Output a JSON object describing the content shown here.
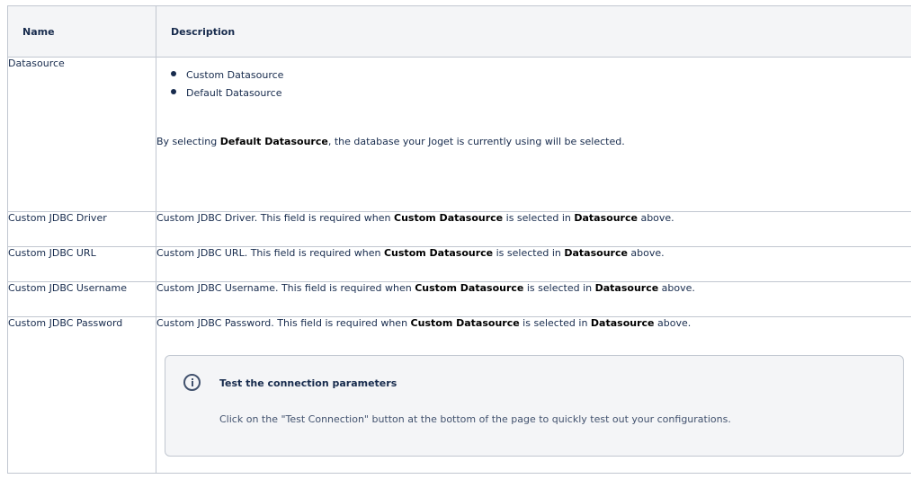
{
  "table": {
    "headers": {
      "name": "Name",
      "description": "Description"
    },
    "datasource": {
      "name": "Datasource",
      "options": [
        "Custom Datasource",
        "Default Datasource"
      ],
      "note_prefix": "By selecting ",
      "note_bold": "Default Datasource",
      "note_suffix": ", the database your Joget is currently using will be selected."
    },
    "rows": [
      {
        "name": "Custom JDBC Driver",
        "desc_prefix": "Custom JDBC Driver. This field is required when "
      },
      {
        "name": "Custom JDBC URL",
        "desc_prefix": "Custom JDBC URL. This field is required when "
      },
      {
        "name": "Custom JDBC Username",
        "desc_prefix": "Custom JDBC Username. This field is required when "
      },
      {
        "name": "Custom JDBC Password",
        "desc_prefix": "Custom JDBC Password. This field is required when "
      }
    ],
    "common": {
      "bold1": "Custom Datasource",
      "mid": " is selected in ",
      "bold2": "Datasource",
      "end": " above."
    },
    "info_panel": {
      "icon": "info-icon",
      "title": "Test the connection parameters",
      "body": "Click on the \"Test Connection\" button at the bottom of the page to quickly test out your configurations."
    }
  }
}
